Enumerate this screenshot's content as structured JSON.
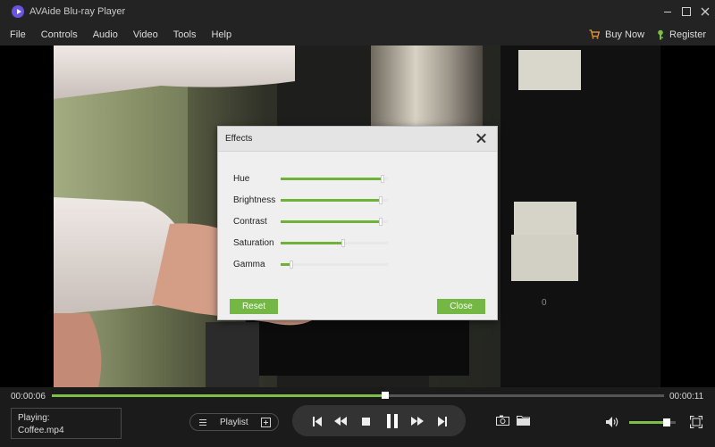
{
  "window": {
    "title": "AVAide Blu-ray Player"
  },
  "menu": {
    "items": [
      "File",
      "Controls",
      "Audio",
      "Video",
      "Tools",
      "Help"
    ],
    "buy_now": "Buy Now",
    "register": "Register"
  },
  "effects": {
    "title": "Effects",
    "sliders": [
      {
        "label": "Hue",
        "value": 0.95
      },
      {
        "label": "Brightness",
        "value": 0.93
      },
      {
        "label": "Contrast",
        "value": 0.93
      },
      {
        "label": "Saturation",
        "value": 0.58
      },
      {
        "label": "Gamma",
        "value": 0.1
      }
    ],
    "reset_label": "Reset",
    "close_label": "Close"
  },
  "video": {
    "overlay_text": "0"
  },
  "player": {
    "current_time": "00:00:06",
    "total_time": "00:00:11",
    "progress": 0.545,
    "playing_label": "Playing:",
    "file_name": "Coffee.mp4",
    "playlist_label": "Playlist",
    "volume": 0.8
  },
  "icons": [
    "app-logo-icon",
    "minimize-icon",
    "maximize-icon",
    "close-icon",
    "cart-icon",
    "key-icon",
    "playlist-icon",
    "playlist-add-icon",
    "previous-icon",
    "rewind-icon",
    "stop-icon",
    "pause-icon",
    "fast-forward-icon",
    "next-icon",
    "snapshot-icon",
    "folder-icon",
    "volume-icon",
    "fullscreen-icon"
  ],
  "colors": {
    "accent": "#74b744",
    "background": "#1b1b1b"
  }
}
